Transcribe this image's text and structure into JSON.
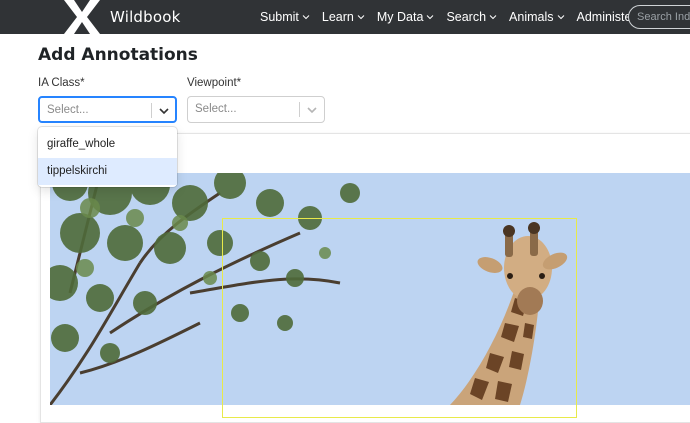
{
  "navbar": {
    "brand": "Wildbook",
    "items": [
      {
        "label": "Submit"
      },
      {
        "label": "Learn"
      },
      {
        "label": "My Data"
      },
      {
        "label": "Search"
      },
      {
        "label": "Animals"
      },
      {
        "label": "Administer"
      }
    ],
    "search_placeholder": "Search Individuals"
  },
  "page": {
    "title": "Add Annotations",
    "ia_class": {
      "label": "IA Class*",
      "placeholder": "Select...",
      "options": [
        "giraffe_whole",
        "tippelskirchi"
      ],
      "highlighted_index": 1
    },
    "viewpoint": {
      "label": "Viewpoint*",
      "placeholder": "Select..."
    }
  },
  "colors": {
    "navbar": "#303336",
    "focus": "#2684ff",
    "option_highlight": "#deebff",
    "bbox": "#e8ea4a",
    "sky": "#bdd4f2"
  }
}
